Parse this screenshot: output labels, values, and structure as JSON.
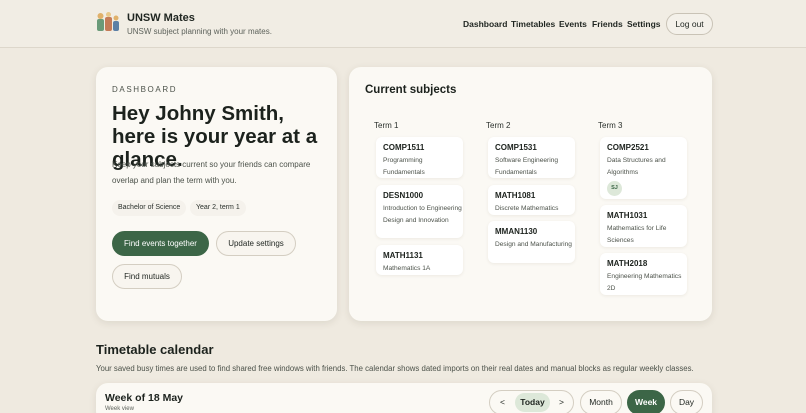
{
  "header": {
    "title": "UNSW Mates",
    "subtitle": "UNSW subject planning with your mates.",
    "nav": [
      "Dashboard",
      "Timetables",
      "Events",
      "Friends",
      "Settings"
    ],
    "logout_label": "Log out"
  },
  "dashboard": {
    "eyebrow": "DASHBOARD",
    "heading": "Hey Johny Smith, here is your year at a glance.",
    "description": "Keep your subjects current so your friends can compare overlap and plan the term with you.",
    "tags": [
      "Bachelor of Science",
      "Year 2, term 1"
    ],
    "buttons": {
      "find_events": "Find events together",
      "update_settings": "Update settings",
      "find_mutuals": "Find mutuals"
    }
  },
  "subjects": {
    "title": "Current subjects",
    "terms": [
      {
        "label": "Term 1",
        "courses": [
          {
            "code": "COMP1511",
            "name": "Programming Fundamentals"
          },
          {
            "code": "DESN1000",
            "name": "Introduction to Engineering Design and Innovation"
          },
          {
            "code": "MATH1131",
            "name": "Mathematics 1A"
          }
        ]
      },
      {
        "label": "Term 2",
        "courses": [
          {
            "code": "COMP1531",
            "name": "Software Engineering Fundamentals"
          },
          {
            "code": "MATH1081",
            "name": "Discrete Mathematics"
          },
          {
            "code": "MMAN1130",
            "name": "Design and Manufacturing"
          }
        ]
      },
      {
        "label": "Term 3",
        "courses": [
          {
            "code": "COMP2521",
            "name": "Data Structures and Algorithms",
            "friend_badge": "SJ"
          },
          {
            "code": "MATH1031",
            "name": "Mathematics for Life Sciences"
          },
          {
            "code": "MATH2018",
            "name": "Engineering Mathematics 2D"
          }
        ]
      }
    ]
  },
  "timetable": {
    "title": "Timetable calendar",
    "description": "Your saved busy times are used to find shared free windows with friends. The calendar shows dated imports on their real dates and manual blocks as regular weekly classes.",
    "week_title": "Week of 18 May",
    "week_view_label": "Week view",
    "prev_label": "<",
    "today_label": "Today",
    "next_label": ">",
    "views": [
      "Month",
      "Week",
      "Day"
    ],
    "active_view": "Week"
  },
  "colors": {
    "accent": "#3c6647",
    "accent_soft": "#dde8d9",
    "background": "#efeae0",
    "card": "#fbf9f4"
  }
}
